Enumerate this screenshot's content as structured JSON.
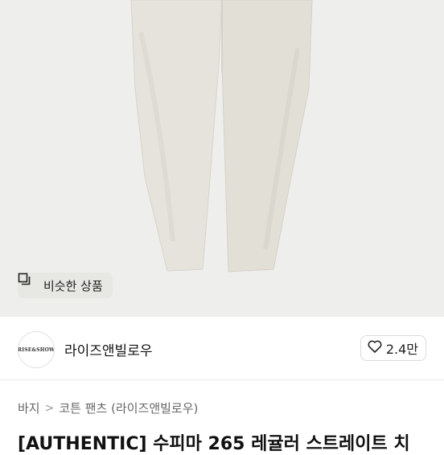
{
  "product_image": {
    "subject": "cream cotton pants",
    "bg_color": "#eeeeec",
    "item_color": "#e4e1d9"
  },
  "similar_button": {
    "label": "비슷한 상품",
    "icon": "copy-icon"
  },
  "seller": {
    "avatar_text": "RISE&SHOW",
    "name": "라이즈앤빌로우"
  },
  "like": {
    "icon": "heart-icon",
    "count": "2.4만"
  },
  "breadcrumb": {
    "level1": "바지",
    "separator": ">",
    "level2": "코튼 팬츠 (라이즈앤빌로우)"
  },
  "title": "[AUTHENTIC] 수피마 265 레귤러 스트레이트 치"
}
